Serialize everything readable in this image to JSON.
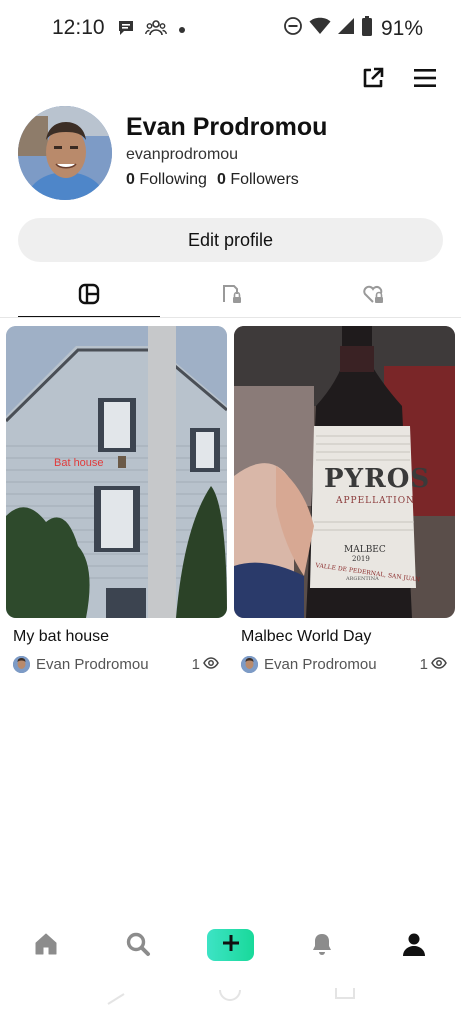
{
  "status_bar": {
    "time": "12:10",
    "battery": "91%"
  },
  "profile": {
    "name": "Evan Prodromou",
    "handle": "evanprodromou",
    "following_count": "0",
    "following_label": "Following",
    "followers_count": "0",
    "followers_label": "Followers",
    "edit_label": "Edit profile"
  },
  "tabs": [
    {
      "icon": "grid-icon",
      "active": true
    },
    {
      "icon": "private-bookmark-icon",
      "active": false
    },
    {
      "icon": "liked-lock-icon",
      "active": false
    }
  ],
  "posts": [
    {
      "title": "My bat house",
      "author": "Evan Prodromou",
      "views": "1",
      "overlay_text": "Bat house"
    },
    {
      "title": "Malbec World Day",
      "author": "Evan Prodromou",
      "views": "1",
      "label_brand": "PYROS",
      "label_sub": "APPELLATION",
      "label_type": "MALBEC",
      "label_year": "2019",
      "label_region": "VALLE DE PEDERNAL, SAN JUAN",
      "label_country": "ARGENTINA"
    }
  ],
  "bottom_nav": [
    "home-icon",
    "search-icon",
    "create-button",
    "notifications-icon",
    "profile-icon"
  ],
  "colors": {
    "accent_gradient_start": "#3de3c5",
    "accent_gradient_end": "#19d99a",
    "edit_button_bg": "#efefef"
  }
}
